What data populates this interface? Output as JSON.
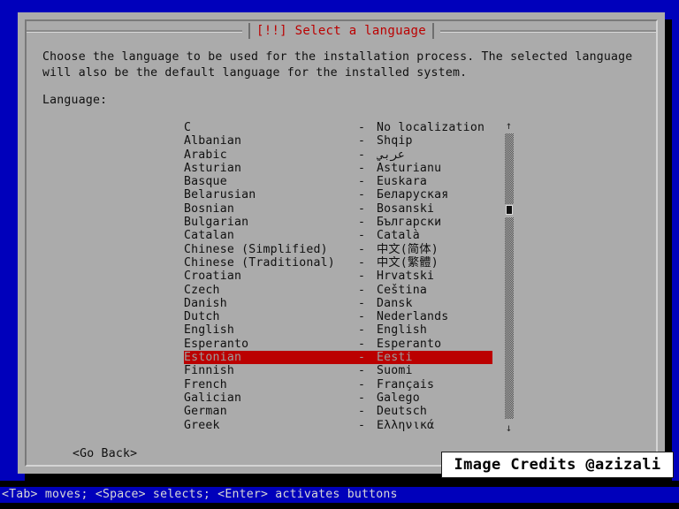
{
  "colors": {
    "backdrop": "#0000bb",
    "dialog_bg": "#ababab",
    "title_red": "#bb0000",
    "highlight_red": "#bb0000",
    "text": "#101010",
    "status_bg": "#0000bb"
  },
  "dialog": {
    "title": "[!!] Select a language",
    "intro": "Choose the language to be used for the installation process. The selected language will also be the default language for the installed system.",
    "language_label": "Language:",
    "go_back_label": "<Go Back>"
  },
  "list": {
    "separator": "-",
    "selected_index": 17,
    "items": [
      {
        "english": "C",
        "native": "No localization"
      },
      {
        "english": "Albanian",
        "native": "Shqip"
      },
      {
        "english": "Arabic",
        "native": "عربي"
      },
      {
        "english": "Asturian",
        "native": "Asturianu"
      },
      {
        "english": "Basque",
        "native": "Euskara"
      },
      {
        "english": "Belarusian",
        "native": "Беларуская"
      },
      {
        "english": "Bosnian",
        "native": "Bosanski"
      },
      {
        "english": "Bulgarian",
        "native": "Български"
      },
      {
        "english": "Catalan",
        "native": "Català"
      },
      {
        "english": "Chinese (Simplified)",
        "native": "中文(简体)"
      },
      {
        "english": "Chinese (Traditional)",
        "native": "中文(繁體)"
      },
      {
        "english": "Croatian",
        "native": "Hrvatski"
      },
      {
        "english": "Czech",
        "native": "Čeština"
      },
      {
        "english": "Danish",
        "native": "Dansk"
      },
      {
        "english": "Dutch",
        "native": "Nederlands"
      },
      {
        "english": "English",
        "native": "English"
      },
      {
        "english": "Esperanto",
        "native": "Esperanto"
      },
      {
        "english": "Estonian",
        "native": "Eesti"
      },
      {
        "english": "Finnish",
        "native": "Suomi"
      },
      {
        "english": "French",
        "native": "Français"
      },
      {
        "english": "Galician",
        "native": "Galego"
      },
      {
        "english": "German",
        "native": "Deutsch"
      },
      {
        "english": "Greek",
        "native": "Ελληνικά"
      }
    ]
  },
  "scrollbar": {
    "up_arrow": "↑",
    "down_arrow": "↓"
  },
  "watermark": {
    "text": "Image Credits @azizali"
  },
  "statusbar": {
    "text": "<Tab> moves; <Space> selects; <Enter> activates buttons"
  }
}
